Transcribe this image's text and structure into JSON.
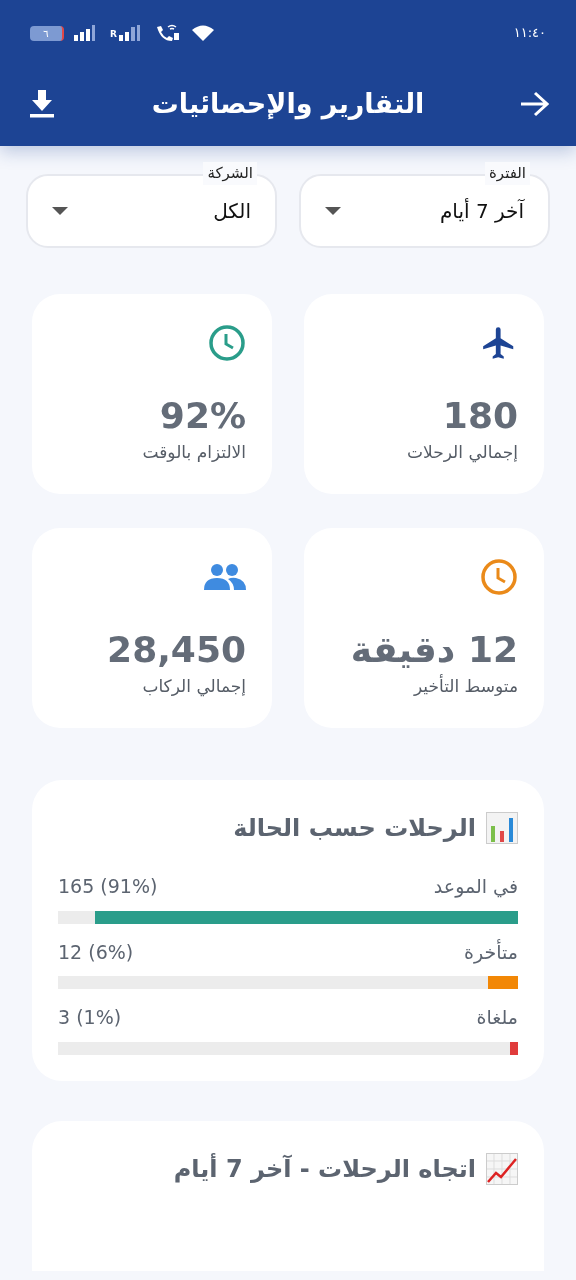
{
  "status_bar": {
    "battery": "٦",
    "network_label": "R",
    "time": "١١:٤٠"
  },
  "app_bar": {
    "title": "التقارير والإحصائيات"
  },
  "filters": [
    {
      "label": "الفترة",
      "value": "آخر 7 أيام"
    },
    {
      "label": "الشركة",
      "value": "الكل"
    }
  ],
  "stats": [
    {
      "value": "180",
      "label": "إجمالي الرحلات"
    },
    {
      "value": "92%",
      "label": "الالتزام بالوقت"
    },
    {
      "value": "12 دقيقة",
      "label": "متوسط التأخير"
    },
    {
      "value": "28,450",
      "label": "إجمالي الركاب"
    }
  ],
  "status_card": {
    "title": "الرحلات حسب الحالة",
    "rows": [
      {
        "label": "في الموعد",
        "reading": "165 (91%)",
        "level": 0.92,
        "color": "#2a9d8a"
      },
      {
        "label": "متأخرة",
        "reading": "12 (6%)",
        "level": 0.065,
        "color": "#f28705"
      },
      {
        "label": "ملغاة",
        "reading": "3 (1%)",
        "level": 0.017,
        "color": "#e03c3c"
      }
    ]
  },
  "trend_card": {
    "title": "اتجاه الرحلات - آخر 7 أيام"
  }
}
